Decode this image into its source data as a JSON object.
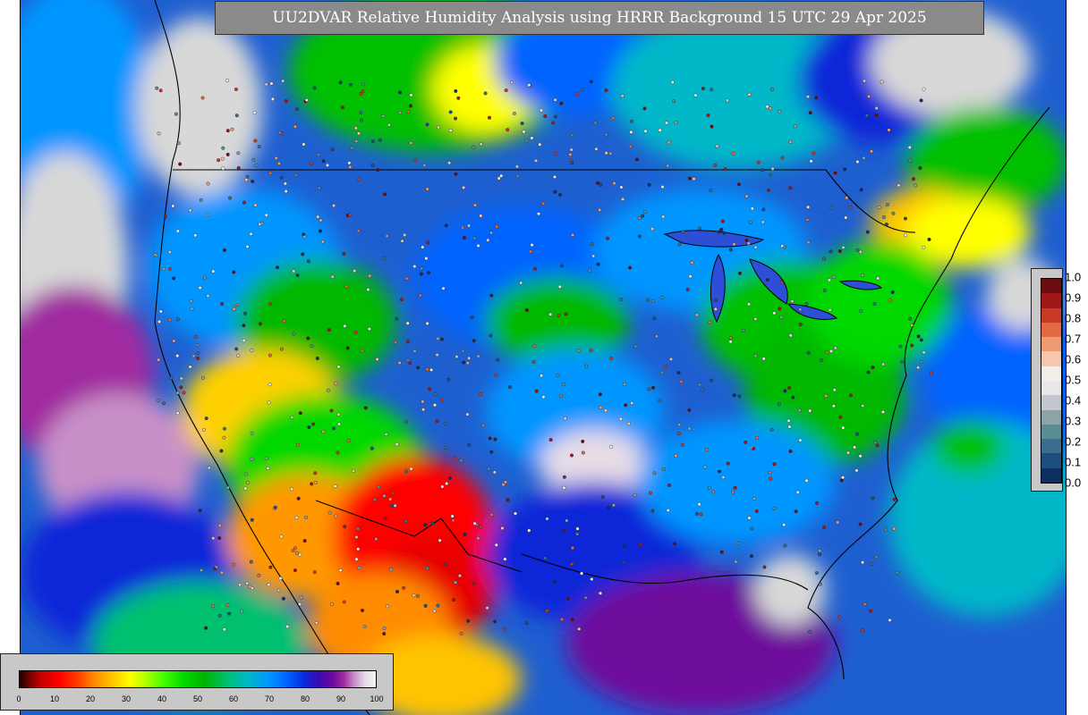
{
  "title": "UU2DVAR Relative Humidity Analysis using HRRR Background 15 UTC 29 Apr 2025",
  "rh_colorbar": {
    "ticks": [
      "0",
      "10",
      "20",
      "30",
      "40",
      "50",
      "60",
      "70",
      "80",
      "90",
      "100"
    ]
  },
  "obs_colorbar": {
    "ticks": [
      "1.0",
      "0.9",
      "0.8",
      "0.7",
      "0.6",
      "0.5",
      "0.4",
      "0.3",
      "0.2",
      "0.1",
      "0.0"
    ],
    "colors_top_to_bottom": [
      "#6b0c10",
      "#a01818",
      "#c83a26",
      "#e36a3e",
      "#f09a74",
      "#f8c6ae",
      "#f2eeea",
      "#e8e8e8",
      "#c4c8cc",
      "#8aa4a8",
      "#5a8c94",
      "#3a6e8c",
      "#1e4e7e",
      "#0e3060"
    ]
  },
  "colors": {
    "ocean": "#1e5fd0",
    "dry": "#e80000",
    "moderate": "#00b800",
    "moist": "#0096ff",
    "saturated": "#d8d8d8"
  }
}
